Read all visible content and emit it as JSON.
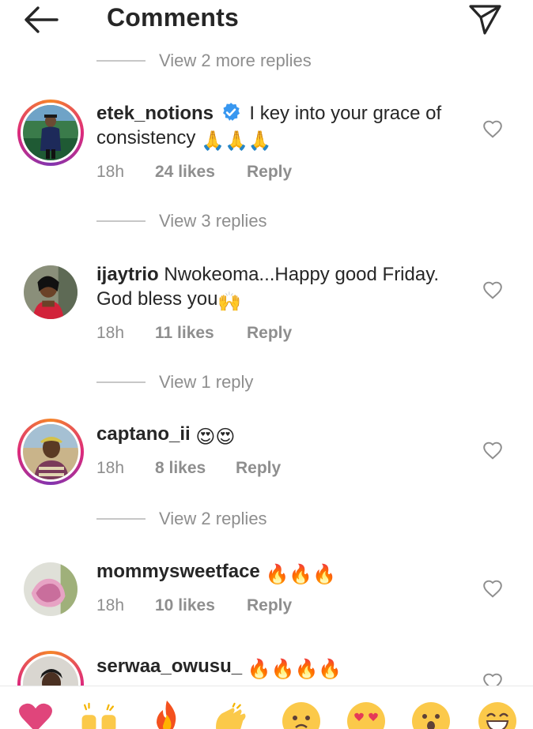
{
  "header": {
    "title": "Comments",
    "back_icon": "arrow-left-icon",
    "share_icon": "paper-plane-icon"
  },
  "top_replies": {
    "label": "View 2 more replies"
  },
  "comments": [
    {
      "username": "etek_notions",
      "verified": true,
      "text": "I key into your grace of consistency",
      "emojis": "🙏🙏🙏",
      "time": "18h",
      "likes": "24 likes",
      "reply": "Reply",
      "replies_label": "View 3 replies"
    },
    {
      "username": "ijaytrio",
      "verified": false,
      "text": "Nwokeoma...Happy good Friday. God bless you",
      "emojis": "🙌",
      "time": "18h",
      "likes": "11 likes",
      "reply": "Reply",
      "replies_label": "View 1 reply"
    },
    {
      "username": "captano_ii",
      "verified": false,
      "text": "",
      "emojis": "😍😍",
      "time": "18h",
      "likes": "8 likes",
      "reply": "Reply",
      "replies_label": "View 2 replies"
    },
    {
      "username": "mommysweetface",
      "verified": false,
      "text": "",
      "emojis": "🔥🔥🔥",
      "time": "18h",
      "likes": "10 likes",
      "reply": "Reply"
    },
    {
      "username": "serwaa_owusu_",
      "verified": false,
      "text": "",
      "emojis": "🔥🔥🔥🔥"
    }
  ],
  "emoji_bar": [
    "❤️",
    "🙌",
    "🔥",
    "👏",
    "😢",
    "😍",
    "😮",
    "😂"
  ],
  "colors": {
    "text": "#262626",
    "secondary": "#8e8e8e",
    "verified": "#3897f0",
    "story_ring": "#dd2a7b"
  }
}
